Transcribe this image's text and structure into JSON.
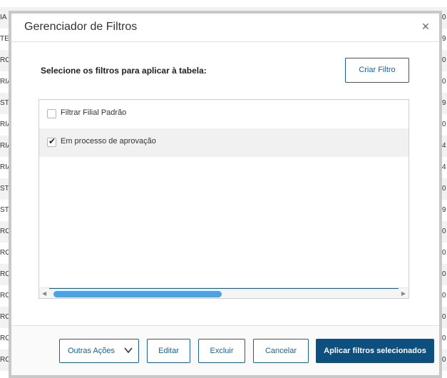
{
  "background": {
    "rows": [
      {
        "left": "IA",
        "right": "0"
      },
      {
        "left": "TE",
        "right": "9"
      },
      {
        "left": "RO",
        "right": "0"
      },
      {
        "left": "RIA",
        "right": "0"
      },
      {
        "left": "ST",
        "right": "9"
      },
      {
        "left": "RIA",
        "right": "0"
      },
      {
        "left": "RIA",
        "right": "4"
      },
      {
        "left": "RIA",
        "right": "4"
      },
      {
        "left": "ST",
        "right": "0"
      },
      {
        "left": "ST",
        "right": "9"
      },
      {
        "left": "RO",
        "right": "0"
      },
      {
        "left": "RO",
        "right": "0"
      },
      {
        "left": "RO",
        "right": "0"
      },
      {
        "left": "RO",
        "right": "0"
      },
      {
        "left": "RO",
        "right": "0"
      },
      {
        "left": "RO",
        "right": "0"
      },
      {
        "left": "RO",
        "right": "0"
      }
    ]
  },
  "modal": {
    "title": "Gerenciador de Filtros",
    "close_icon": "×",
    "instructions": "Selecione os filtros para aplicar à tabela:",
    "create_filter_label": "Criar Filtro",
    "filters": [
      {
        "label": "Filtrar Filial Padrão",
        "checked": false
      },
      {
        "label": "Em processo de aprovação",
        "checked": true
      }
    ],
    "footer": {
      "other_actions_label": "Outras Ações",
      "edit_label": "Editar",
      "delete_label": "Excluir",
      "cancel_label": "Cancelar",
      "apply_label": "Aplicar filtros selecionados"
    }
  },
  "colors": {
    "primary": "#0d4f7e",
    "accent": "#1a5f95",
    "scroll_thumb": "#4ea1e2"
  }
}
